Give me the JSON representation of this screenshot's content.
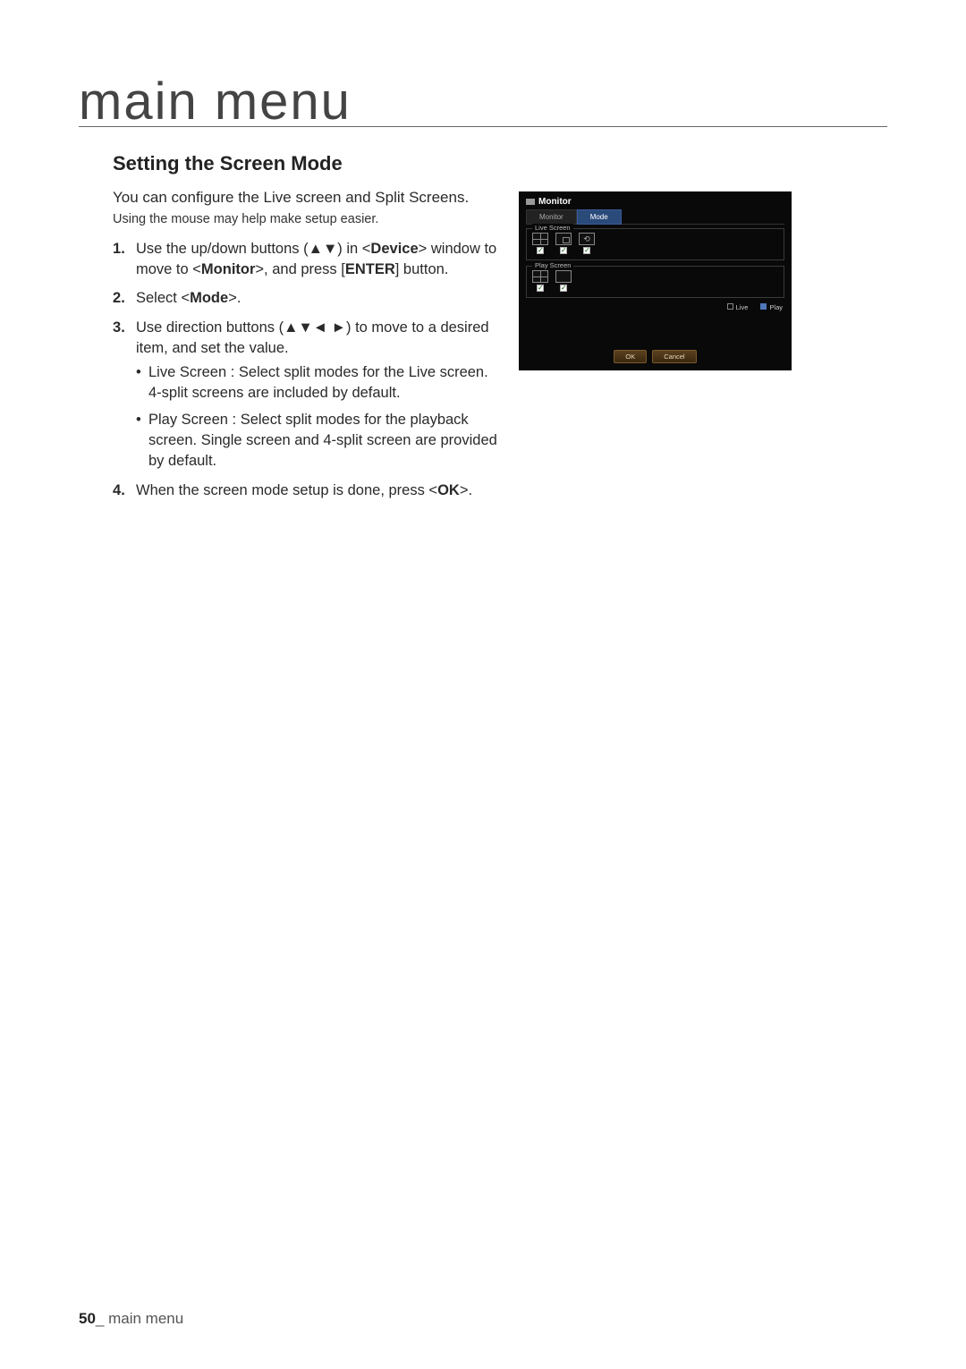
{
  "page": {
    "title": "main menu",
    "heading": "Setting the Screen Mode",
    "intro": "You can configure the Live screen and Split Screens.",
    "hint": "Using the mouse may help make setup easier.",
    "steps": {
      "s1a": "Use the up/down buttons (▲▼) in <",
      "s1b": "Device",
      "s1c": "> window to move to <",
      "s1d": "Monitor",
      "s1e": ">, and press [",
      "s1f": "ENTER",
      "s1g": "] button.",
      "s2a": "Select <",
      "s2b": "Mode",
      "s2c": ">.",
      "s3": "Use direction buttons (▲▼◄ ►) to move to a desired item, and set the value.",
      "b1": "Live Screen : Select split modes for the Live screen. 4-split screens are included by default.",
      "b2": "Play Screen : Select split modes for the playback screen. Single screen and 4-split screen are provided by default.",
      "s4a": "When the screen mode setup is done, press <",
      "s4b": "OK",
      "s4c": ">."
    }
  },
  "screenshot": {
    "title": "Monitor",
    "tabs": {
      "monitor": "Monitor",
      "mode": "Mode"
    },
    "live_legend": "Live Screen",
    "play_legend": "Play Screen",
    "legend_live": "Live",
    "legend_play": "Play",
    "ok": "OK",
    "cancel": "Cancel"
  },
  "footer": {
    "page_number": "50",
    "sep": "_ ",
    "label": "main menu"
  }
}
